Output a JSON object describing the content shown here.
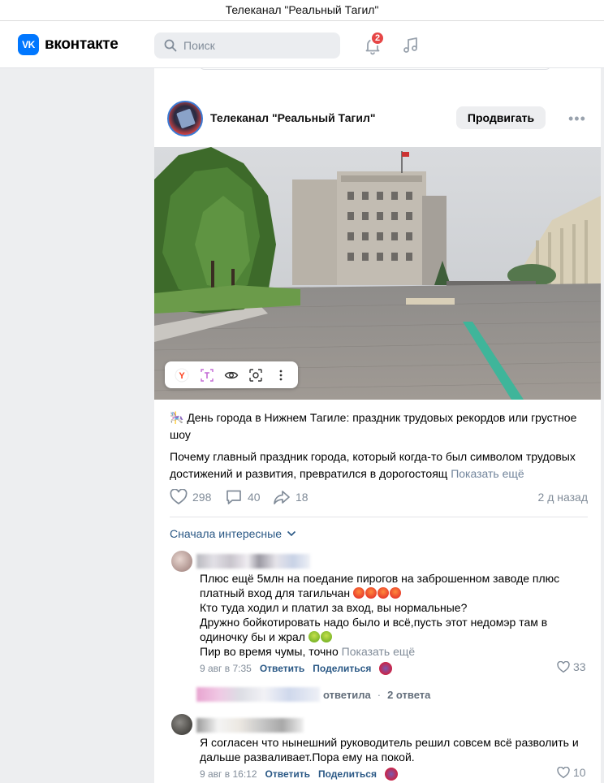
{
  "window": {
    "title": "Телеканал \"Реальный Тагил\""
  },
  "header": {
    "logo_mark": "VK",
    "logo_text": "вконтакте",
    "search_placeholder": "Поиск",
    "notifications_count": "2"
  },
  "post": {
    "author": "Телеканал \"Реальный Тагил\"",
    "promote_label": "Продвигать",
    "more_label": "•••",
    "title": "🎠 День города в Нижнем Тагиле: праздник трудовых рекордов или грустное шоу",
    "text": "Почему главный праздник города, который когда-то был символом трудовых достижений и развития, превратился в дорогостоящ",
    "show_more": "Показать ещё",
    "likes": "298",
    "comments": "40",
    "shares": "18",
    "time": "2 д назад",
    "sort_label": "Сначала интересные"
  },
  "comments": [
    {
      "text_lines": [
        "Плюс ещё 5млн на поедание пирогов на заброшенном заводе плюс",
        "платный вход для тагильчан",
        "Кто туда ходил и платил за вход, вы нормальные?",
        "Дружно бойкотировать надо было и всё,пусть этот недомэр там в",
        "одиночку бы и жрал",
        "Пир во время чумы, точно"
      ],
      "show_more": "Показать ещё",
      "date": "9 авг в 7:35",
      "reply_label": "Ответить",
      "share_label": "Поделиться",
      "likes": "33"
    },
    {
      "text_lines": [
        "Я согласен что нынешний руководитель решил совсем всё разволить и",
        "дальше разваливает.Пора ему на покой."
      ],
      "date": "9 авг в 16:12",
      "reply_label": "Ответить",
      "share_label": "Поделиться",
      "likes": "10"
    }
  ],
  "reply_thread": {
    "replied": "ответила",
    "dot": "·",
    "count": "2 ответа"
  },
  "colors": {
    "brand": "#0077ff",
    "link": "#2a5885",
    "muted": "#818c99",
    "badge": "#e64646"
  }
}
